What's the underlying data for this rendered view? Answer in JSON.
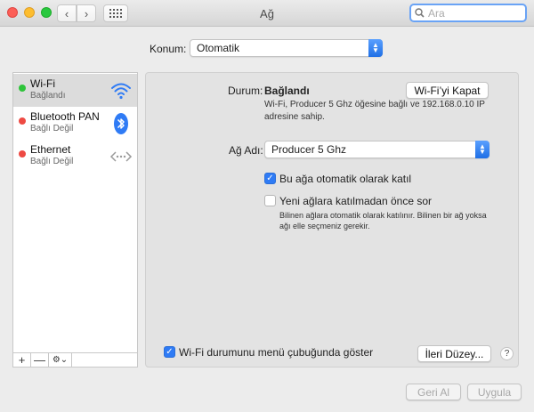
{
  "window": {
    "title": "Ağ"
  },
  "search": {
    "placeholder": "Ara"
  },
  "location": {
    "label": "Konum:",
    "value": "Otomatik"
  },
  "services": [
    {
      "name": "Wi-Fi",
      "status": "Bağlandı",
      "status_color": "#2ec43a",
      "icon": "wifi-icon"
    },
    {
      "name": "Bluetooth PAN",
      "status": "Bağlı Değil",
      "status_color": "#ee4a43",
      "icon": "bluetooth-icon"
    },
    {
      "name": "Ethernet",
      "status": "Bağlı Değil",
      "status_color": "#ee4a43",
      "icon": "ethernet-icon"
    }
  ],
  "sidebar_controls": {
    "add": "+",
    "remove": "—",
    "gear": "⚙⌄"
  },
  "detail": {
    "status_label": "Durum:",
    "status_value": "Bağlandı",
    "toggle_wifi_button": "Wi-Fi’yi Kapat",
    "status_description": "Wi-Fi, Producer 5 Ghz öğesine bağlı ve 192.168.0.10 IP adresine sahip.",
    "network_label": "Ağ Adı:",
    "network_value": "Producer 5 Ghz",
    "auto_join_label": "Bu ağa otomatik olarak katıl",
    "ask_join_label": "Yeni ağlara katılmadan önce sor",
    "ask_join_description": "Bilinen ağlara otomatik olarak katılınır. Bilinen bir ağ yoksa ağı elle seçmeniz gerekir.",
    "show_menu_label": "Wi-Fi durumunu menü çubuğunda göster",
    "advanced_button": "İleri Düzey...",
    "help_button": "?"
  },
  "footer": {
    "revert_button": "Geri Al",
    "apply_button": "Uygula"
  },
  "accent_color": "#2f7bf5"
}
